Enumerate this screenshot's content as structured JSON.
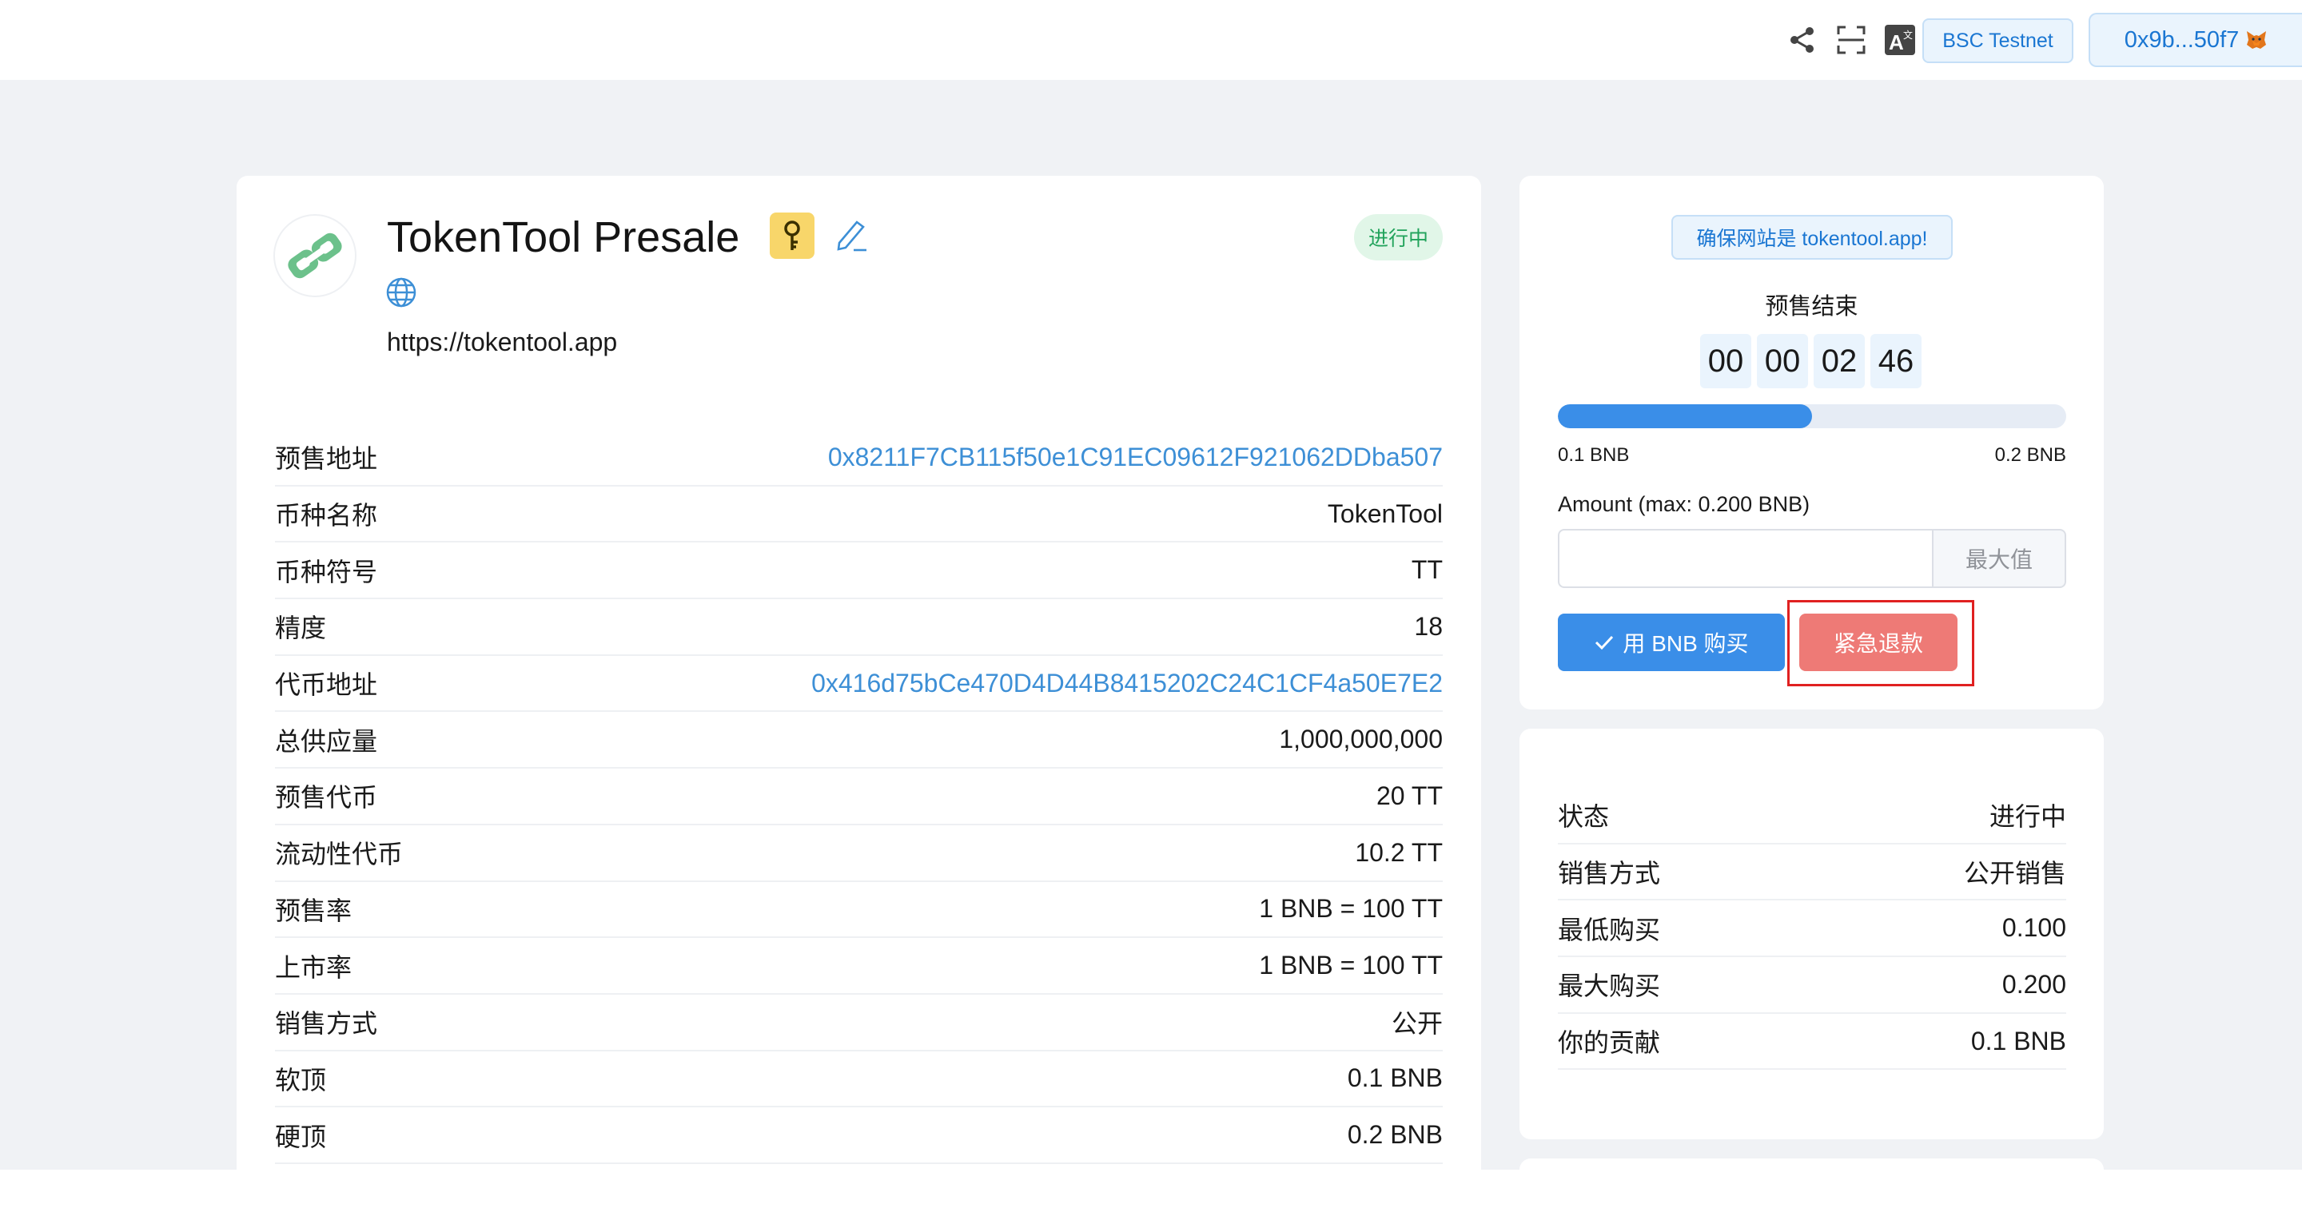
{
  "topbar": {
    "icons": [
      "share-icon",
      "scan-icon",
      "translate-icon"
    ],
    "chain_label": "BSC Testnet",
    "wallet_label": "0x9b...50f7",
    "wallet_icon": "metamask-fox-icon"
  },
  "presale": {
    "title": "TokenTool Presale",
    "status": "进行中",
    "website": "https://tokentool.app",
    "details": [
      {
        "label": "预售地址",
        "value": "0x8211F7CB115f50e1C91EC09612F921062DDba507",
        "link": true
      },
      {
        "label": "币种名称",
        "value": "TokenTool",
        "link": false
      },
      {
        "label": "币种符号",
        "value": "TT",
        "link": false
      },
      {
        "label": "精度",
        "value": "18",
        "link": false
      },
      {
        "label": "代币地址",
        "value": "0x416d75bCe470D4D44B8415202C24C1CF4a50E7E2",
        "link": true
      },
      {
        "label": "总供应量",
        "value": "1,000,000,000",
        "link": false
      },
      {
        "label": "预售代币",
        "value": "20 TT",
        "link": false
      },
      {
        "label": "流动性代币",
        "value": "10.2 TT",
        "link": false
      },
      {
        "label": "预售率",
        "value": "1 BNB = 100 TT",
        "link": false
      },
      {
        "label": "上市率",
        "value": "1 BNB = 100 TT",
        "link": false
      },
      {
        "label": "销售方式",
        "value": "公开",
        "link": false
      },
      {
        "label": "软顶",
        "value": "0.1 BNB",
        "link": false
      },
      {
        "label": "硬顶",
        "value": "0.2 BNB",
        "link": false
      }
    ]
  },
  "buy": {
    "notice": "确保网站是 tokentool.app!",
    "ends_label": "预售结束",
    "countdown": [
      "00",
      "00",
      "02",
      "46"
    ],
    "progress_fraction": 0.5,
    "progress_min": "0.1 BNB",
    "progress_max": "0.2 BNB",
    "amount_label": "Amount (max: 0.200 BNB)",
    "amount_value": "",
    "max_label": "最大值",
    "buy_label": "用 BNB 购买",
    "refund_label": "紧急退款",
    "colors": {
      "primary": "#3a8ee8",
      "danger": "#ee7a76",
      "highlight_frame": "#e02020"
    }
  },
  "info": [
    {
      "label": "状态",
      "value": "进行中"
    },
    {
      "label": "销售方式",
      "value": "公开销售"
    },
    {
      "label": "最低购买",
      "value": "0.100"
    },
    {
      "label": "最大购买",
      "value": "0.200"
    },
    {
      "label": "你的贡献",
      "value": "0.1 BNB"
    }
  ]
}
